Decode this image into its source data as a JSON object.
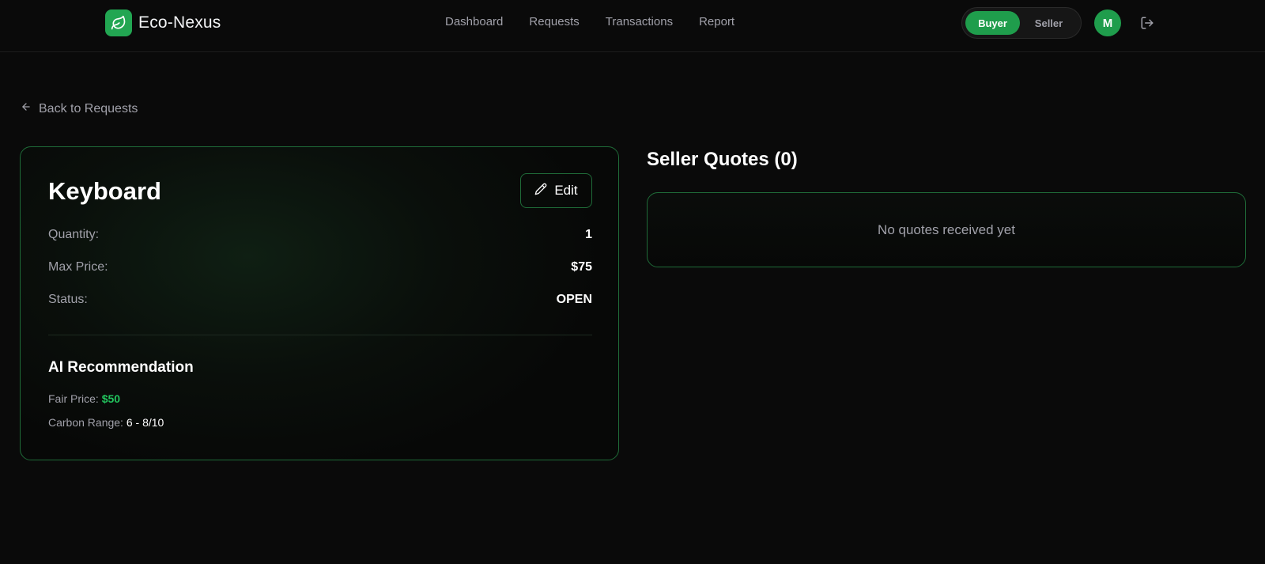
{
  "header": {
    "brand": "Eco-Nexus",
    "nav": [
      "Dashboard",
      "Requests",
      "Transactions",
      "Report"
    ],
    "role_toggle": {
      "buyer": "Buyer",
      "seller": "Seller",
      "active": "Buyer"
    },
    "avatar_initial": "M"
  },
  "back_link": "Back to Requests",
  "request": {
    "title": "Keyboard",
    "edit_label": "Edit",
    "fields": [
      {
        "label": "Quantity:",
        "value": "1"
      },
      {
        "label": "Max Price:",
        "value": "$75"
      },
      {
        "label": "Status:",
        "value": "OPEN"
      }
    ],
    "ai": {
      "title": "AI Recommendation",
      "fair_price_label": "Fair Price:",
      "fair_price_value": "$50",
      "carbon_label": "Carbon Range:",
      "carbon_value": "6 - 8/10"
    }
  },
  "quotes": {
    "title": "Seller Quotes (0)",
    "empty_message": "No quotes received yet"
  },
  "colors": {
    "accent": "#1f9d4c",
    "accent_text": "#22c55e",
    "card_border": "#1f6b38",
    "background": "#0a0a0a"
  },
  "icons": {
    "brand": "leaf-icon",
    "back": "arrow-left-icon",
    "edit": "pencil-icon",
    "logout": "logout-icon"
  }
}
